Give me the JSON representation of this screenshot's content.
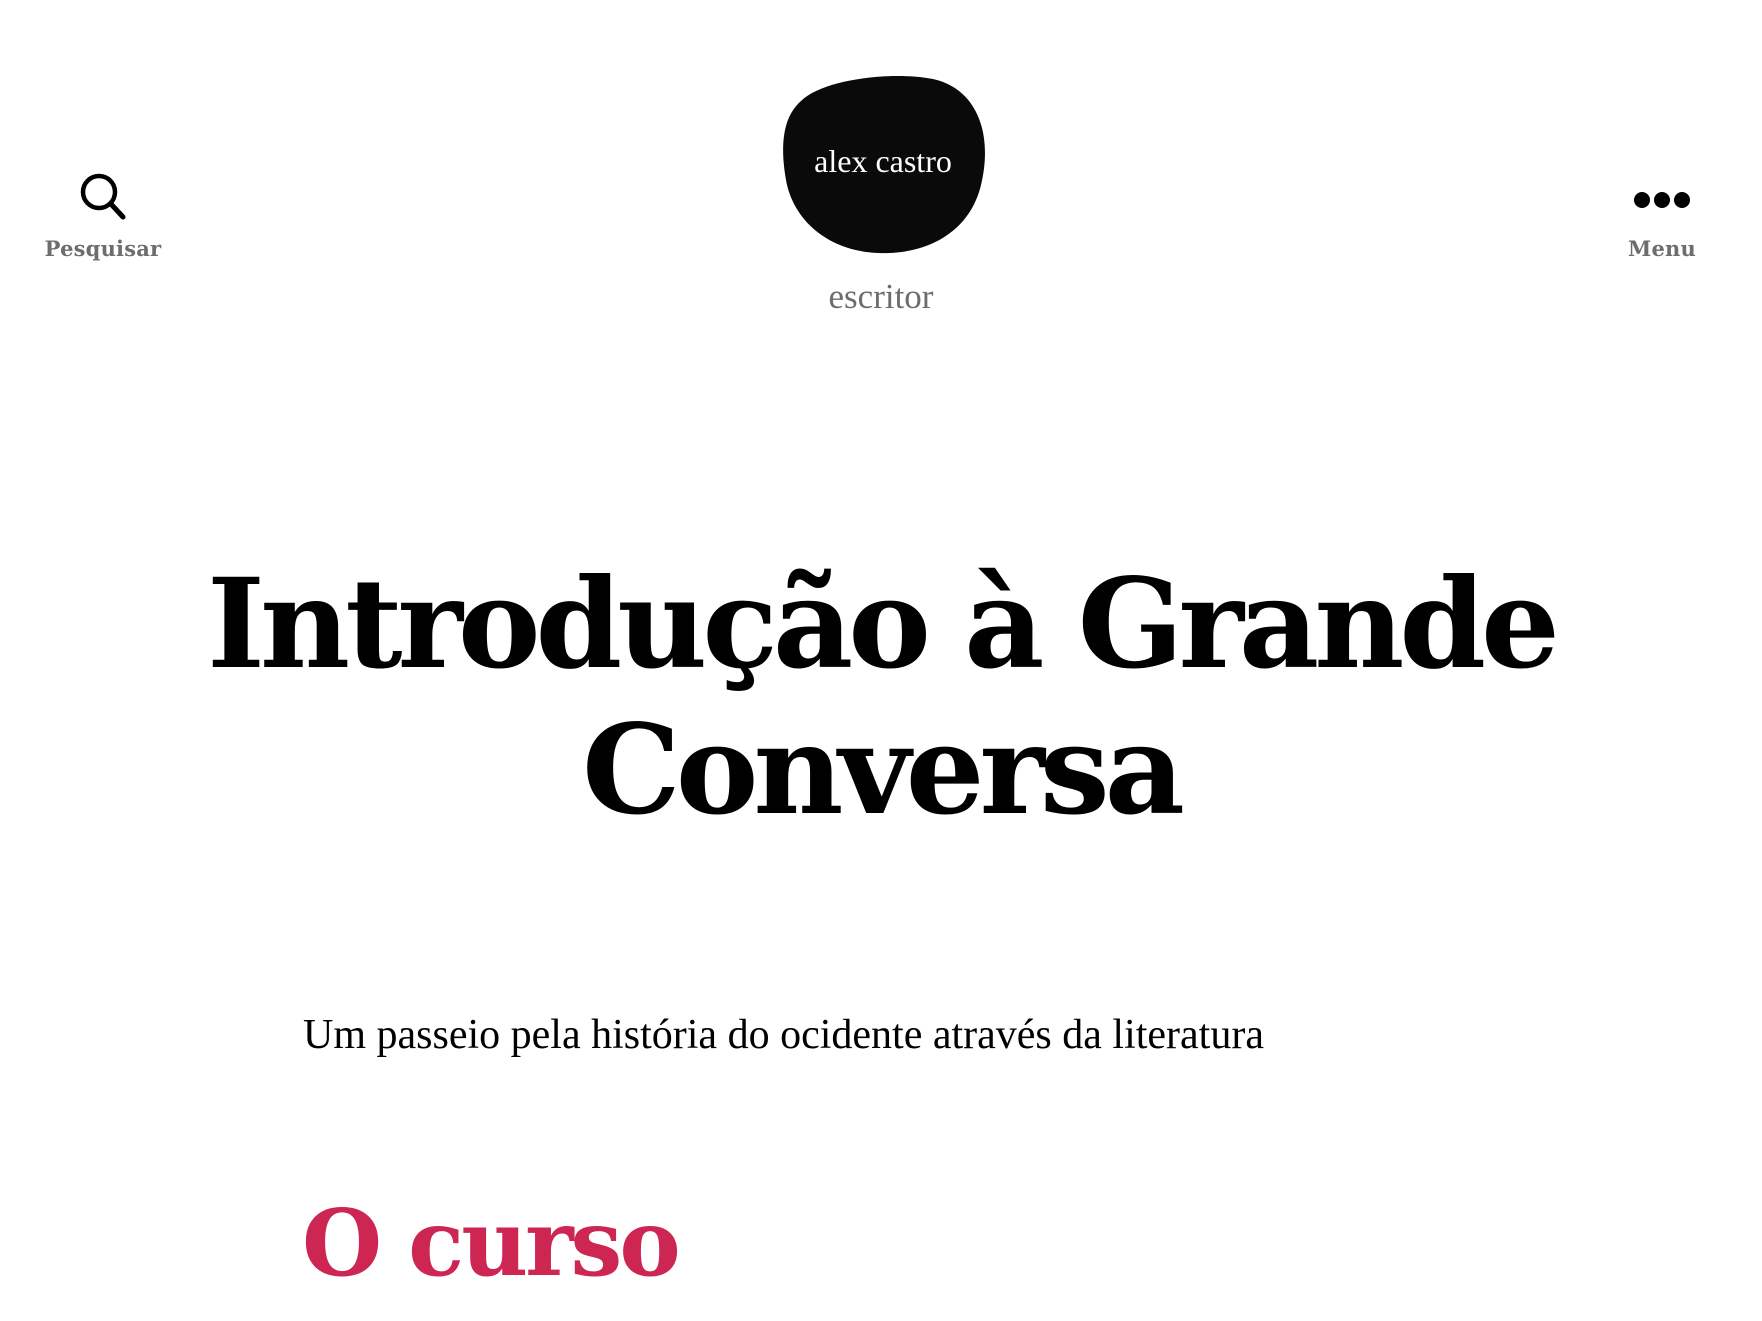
{
  "header": {
    "search": {
      "label": "Pesquisar",
      "icon": "search-icon"
    },
    "menu": {
      "label": "Menu",
      "icon": "ellipsis-icon"
    },
    "logo": {
      "text": "alex castro"
    },
    "tagline": "escritor"
  },
  "page": {
    "title": "Introdução à Grande Conversa",
    "intro": "Um passeio pela história do ocidente através da literatura",
    "section_heading": "O curso"
  },
  "colors": {
    "accent": "#cd2653",
    "secondary_text": "#6d6d6d",
    "text": "#000000",
    "background": "#ffffff"
  }
}
